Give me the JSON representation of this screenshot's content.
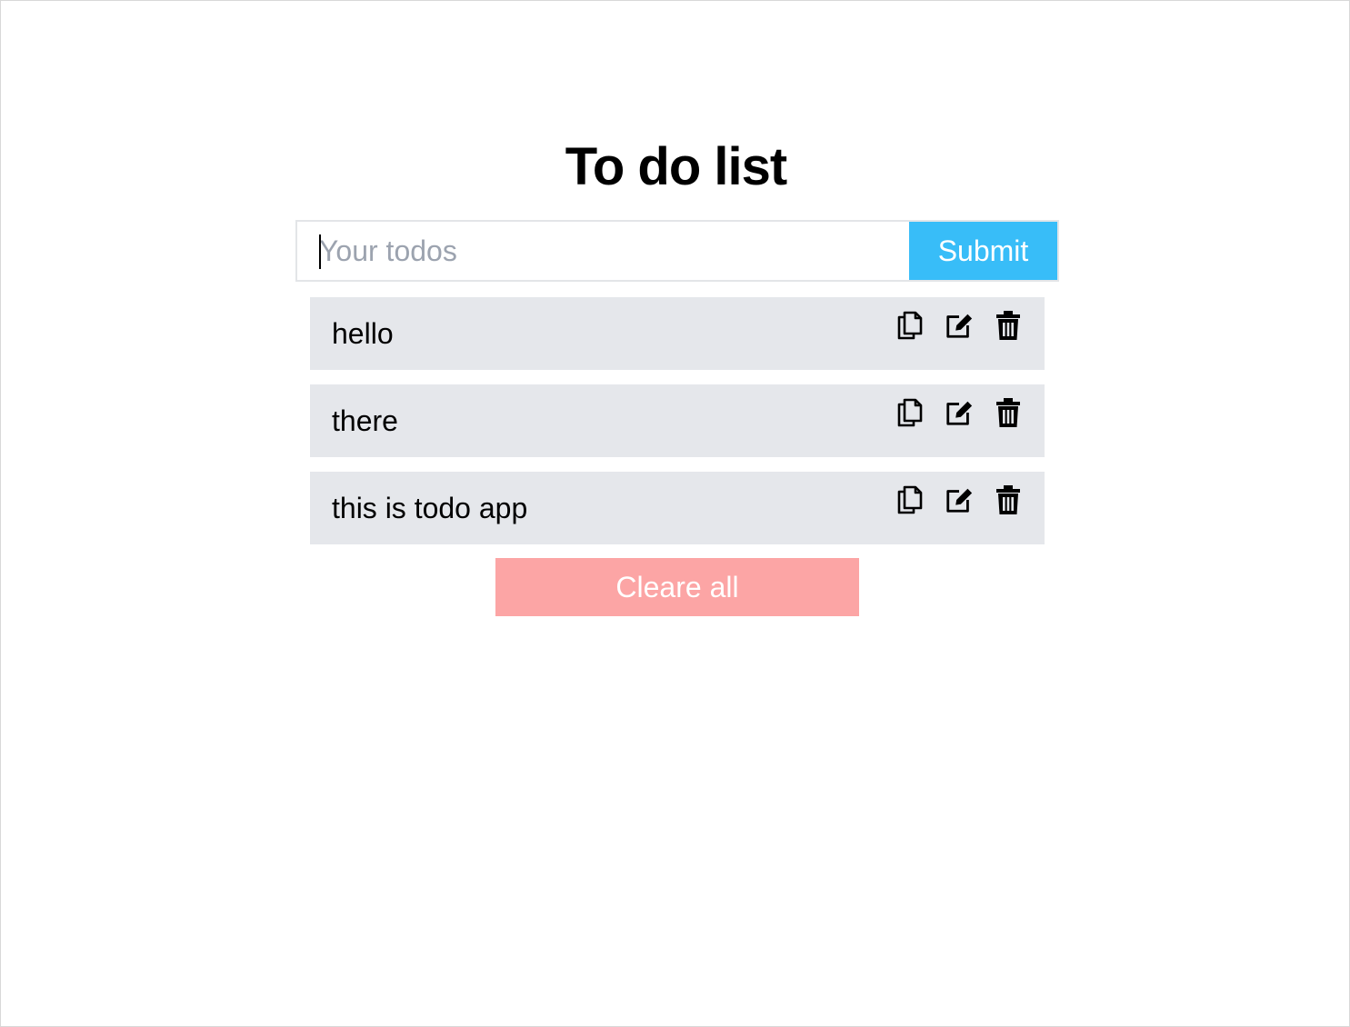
{
  "header": {
    "title": "To do list"
  },
  "form": {
    "input_value": "",
    "input_placeholder": "Your todos",
    "submit_label": "Submit"
  },
  "todos": [
    {
      "text": "hello",
      "icons": [
        "copy-icon",
        "edit-icon",
        "trash-icon"
      ]
    },
    {
      "text": "there",
      "icons": [
        "copy-icon",
        "edit-icon",
        "trash-icon"
      ]
    },
    {
      "text": "this is todo app",
      "icons": [
        "copy-icon",
        "edit-icon",
        "trash-icon"
      ]
    }
  ],
  "clear_label": "Cleare all",
  "colors": {
    "submit": "#38bdf8",
    "clear": "#fca5a5",
    "item_bg": "#e5e7eb"
  }
}
